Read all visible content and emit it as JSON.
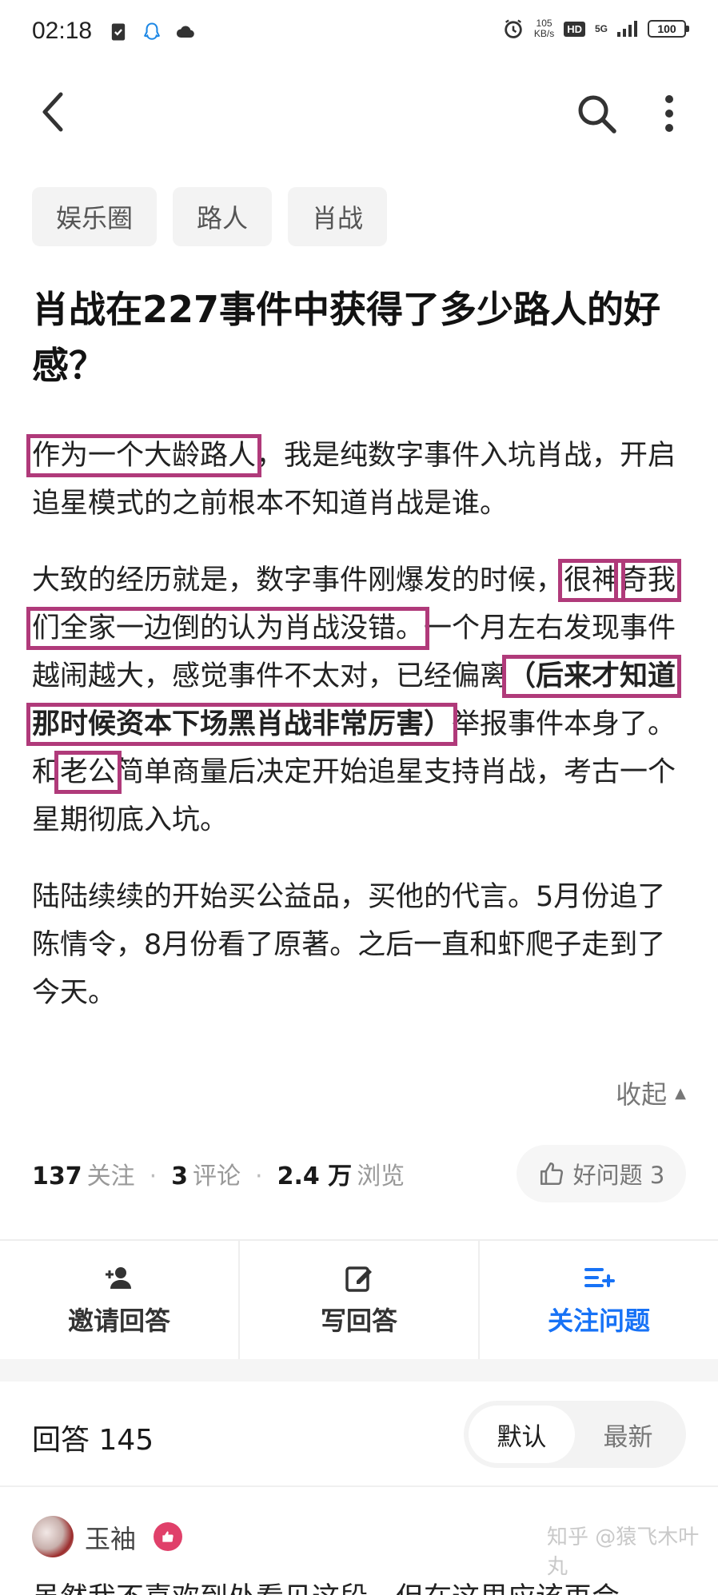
{
  "status_bar": {
    "time": "02:18",
    "net_speed_value": "105",
    "net_speed_unit": "KB/s",
    "hd": "HD",
    "network": "5G",
    "battery": "100"
  },
  "tags": [
    "娱乐圈",
    "路人",
    "肖战"
  ],
  "question": {
    "title": "肖战在227事件中获得了多少路人的好感？",
    "p1_hl": "作为一个大龄路人",
    "p1_rest": "，我是纯数字事件入坑肖战，开启追星模式的之前根本不知道肖战是谁。",
    "p2_a": "大致的经历就是，数字事件刚爆发的时候，",
    "p2_hl1": "很神",
    "p2_hl2": "奇我们全家一边倒的认为肖战没错。",
    "p2_b": "一个月左右发现事件越闹越大，感觉事件不太对，已经偏离",
    "p2_bold": "（后来才知道那时候资本下场黑肖战非常厉害）",
    "p2_c": "举报事件本身了。和",
    "p2_hl3": "老公",
    "p2_d": "简单商量后决定开始追星支持肖战，考古一个星期彻底入坑。",
    "p3": "陆陆续续的开始买公益品，买他的代言。5月份追了陈情令，8月份看了原著。之后一直和虾爬子走到了今天。",
    "collapse_label": "收起"
  },
  "stats": {
    "follow_count": "137",
    "follow_label": "关注",
    "comment_count": "3",
    "comment_label": "评论",
    "view_count": "2.4 万",
    "view_label": "浏览",
    "good_question": "好问题 3"
  },
  "actions": {
    "invite": "邀请回答",
    "write": "写回答",
    "follow": "关注问题"
  },
  "answers": {
    "count_label": "回答 145",
    "sort_default": "默认",
    "sort_latest": "最新"
  },
  "first_answer": {
    "author": "玉袖",
    "text": "虽然我不喜欢到处看见这段，但在这里应该再会",
    "watermark": "知乎 @猿飞木叶丸"
  },
  "colors": {
    "highlight_box": "#b03a7a",
    "accent_blue": "#1772f6"
  }
}
